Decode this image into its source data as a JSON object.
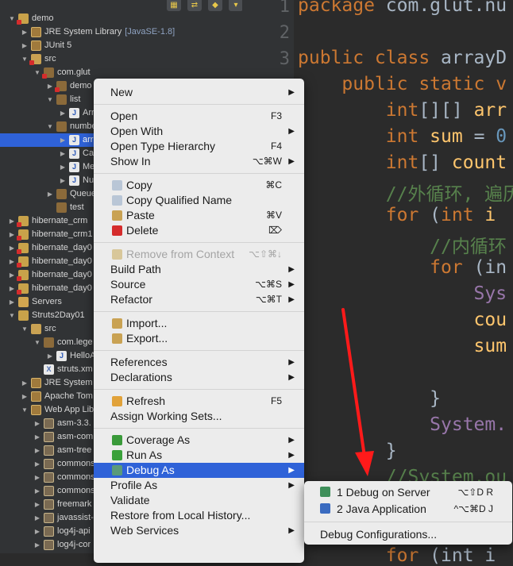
{
  "explorer": {
    "rows": [
      {
        "label": "demo",
        "deco": "",
        "arrow": "▼",
        "indent": 0,
        "icon": "ic-project",
        "err": true
      },
      {
        "label": "JRE System Library",
        "deco": "[JavaSE-1.8]",
        "arrow": "▶",
        "indent": 1,
        "icon": "ic-lib",
        "err": false
      },
      {
        "label": "JUnit 5",
        "deco": "",
        "arrow": "▶",
        "indent": 1,
        "icon": "ic-lib",
        "err": false
      },
      {
        "label": "src",
        "deco": "",
        "arrow": "▼",
        "indent": 1,
        "icon": "ic-src",
        "err": true
      },
      {
        "label": "com.glut",
        "deco": "",
        "arrow": "▼",
        "indent": 2,
        "icon": "ic-pkg",
        "err": true
      },
      {
        "label": "demo",
        "deco": "",
        "arrow": "▶",
        "indent": 3,
        "icon": "ic-pkg",
        "err": true
      },
      {
        "label": "list",
        "deco": "",
        "arrow": "▼",
        "indent": 3,
        "icon": "ic-pkg",
        "err": false
      },
      {
        "label": "Arr",
        "deco": "",
        "arrow": "▶",
        "indent": 4,
        "icon": "ic-java",
        "err": false
      },
      {
        "label": "numbe",
        "deco": "",
        "arrow": "▼",
        "indent": 3,
        "icon": "ic-pkg",
        "err": false
      },
      {
        "label": "arra",
        "deco": "",
        "arrow": "▶",
        "indent": 4,
        "icon": "ic-java",
        "err": false,
        "selected": true
      },
      {
        "label": "Cal",
        "deco": "",
        "arrow": "▶",
        "indent": 4,
        "icon": "ic-java",
        "err": false
      },
      {
        "label": "Me",
        "deco": "",
        "arrow": "▶",
        "indent": 4,
        "icon": "ic-java",
        "err": false
      },
      {
        "label": "Nu",
        "deco": "",
        "arrow": "▶",
        "indent": 4,
        "icon": "ic-java",
        "err": false
      },
      {
        "label": "Queue",
        "deco": "",
        "arrow": "▶",
        "indent": 3,
        "icon": "ic-pkg",
        "err": false
      },
      {
        "label": "test",
        "deco": "",
        "arrow": "",
        "indent": 3,
        "icon": "ic-pkg",
        "err": false
      },
      {
        "label": "hibernate_crm",
        "deco": "",
        "arrow": "▶",
        "indent": 0,
        "icon": "ic-project",
        "err": true
      },
      {
        "label": "hibernate_crm1",
        "deco": "",
        "arrow": "▶",
        "indent": 0,
        "icon": "ic-project",
        "err": true
      },
      {
        "label": "hibernate_day0",
        "deco": "",
        "arrow": "▶",
        "indent": 0,
        "icon": "ic-project",
        "err": true
      },
      {
        "label": "hibernate_day0",
        "deco": "",
        "arrow": "▶",
        "indent": 0,
        "icon": "ic-project",
        "err": true
      },
      {
        "label": "hibernate_day0",
        "deco": "",
        "arrow": "▶",
        "indent": 0,
        "icon": "ic-project",
        "err": true
      },
      {
        "label": "hibernate_day0",
        "deco": "",
        "arrow": "▶",
        "indent": 0,
        "icon": "ic-project",
        "err": true
      },
      {
        "label": "Servers",
        "deco": "",
        "arrow": "▶",
        "indent": 0,
        "icon": "ic-folder",
        "err": false
      },
      {
        "label": "Struts2Day01",
        "deco": "",
        "arrow": "▼",
        "indent": 0,
        "icon": "ic-project",
        "err": false
      },
      {
        "label": "src",
        "deco": "",
        "arrow": "▼",
        "indent": 1,
        "icon": "ic-src",
        "err": false
      },
      {
        "label": "com.lege",
        "deco": "",
        "arrow": "▼",
        "indent": 2,
        "icon": "ic-pkg",
        "err": false
      },
      {
        "label": "HelloA",
        "deco": "",
        "arrow": "▶",
        "indent": 3,
        "icon": "ic-java",
        "err": false
      },
      {
        "label": "struts.xm",
        "deco": "",
        "arrow": "",
        "indent": 2,
        "icon": "ic-xml",
        "err": false
      },
      {
        "label": "JRE System",
        "deco": "",
        "arrow": "▶",
        "indent": 1,
        "icon": "ic-lib",
        "err": false
      },
      {
        "label": "Apache Tom",
        "deco": "",
        "arrow": "▶",
        "indent": 1,
        "icon": "ic-lib",
        "err": false
      },
      {
        "label": "Web App Libr",
        "deco": "",
        "arrow": "▼",
        "indent": 1,
        "icon": "ic-lib",
        "err": false
      },
      {
        "label": "asm-3.3.",
        "deco": "",
        "arrow": "▶",
        "indent": 2,
        "icon": "ic-jar",
        "err": false
      },
      {
        "label": "asm-com",
        "deco": "",
        "arrow": "▶",
        "indent": 2,
        "icon": "ic-jar",
        "err": false
      },
      {
        "label": "asm-tree",
        "deco": "",
        "arrow": "▶",
        "indent": 2,
        "icon": "ic-jar",
        "err": false
      },
      {
        "label": "commons",
        "deco": "",
        "arrow": "▶",
        "indent": 2,
        "icon": "ic-jar",
        "err": false
      },
      {
        "label": "commons",
        "deco": "",
        "arrow": "▶",
        "indent": 2,
        "icon": "ic-jar",
        "err": false
      },
      {
        "label": "commons",
        "deco": "",
        "arrow": "▶",
        "indent": 2,
        "icon": "ic-jar",
        "err": false
      },
      {
        "label": "freemark",
        "deco": "",
        "arrow": "▶",
        "indent": 2,
        "icon": "ic-jar",
        "err": false
      },
      {
        "label": "javassist-",
        "deco": "",
        "arrow": "▶",
        "indent": 2,
        "icon": "ic-jar",
        "err": false
      },
      {
        "label": "log4j-api",
        "deco": "",
        "arrow": "▶",
        "indent": 2,
        "icon": "ic-jar",
        "err": false
      },
      {
        "label": "log4j-cor",
        "deco": "",
        "arrow": "▶",
        "indent": 2,
        "icon": "ic-jar",
        "err": false
      }
    ]
  },
  "editor": {
    "line_numbers": [
      "1",
      "2",
      "3"
    ],
    "lines": [
      [
        {
          "t": "package ",
          "c": "kw"
        },
        {
          "t": "com.glut.nu",
          "c": ""
        }
      ],
      [],
      [
        {
          "t": "public class ",
          "c": "kw"
        },
        {
          "t": "arrayD",
          "c": ""
        }
      ],
      [
        {
          "t": "    public static v",
          "c": "kw"
        }
      ],
      [
        {
          "t": "        int",
          "c": "kw"
        },
        {
          "t": "[][] ",
          "c": ""
        },
        {
          "t": "arr",
          "c": "fn"
        }
      ],
      [
        {
          "t": "        int ",
          "c": "kw"
        },
        {
          "t": "sum",
          "c": "fn"
        },
        {
          "t": " = ",
          "c": ""
        },
        {
          "t": "0",
          "c": "num"
        }
      ],
      [
        {
          "t": "        int",
          "c": "kw"
        },
        {
          "t": "[] ",
          "c": ""
        },
        {
          "t": "count",
          "c": "fn"
        }
      ],
      [
        {
          "t": "        //外循环, 遍历",
          "c": "cm"
        }
      ],
      [
        {
          "t": "        for ",
          "c": "kw"
        },
        {
          "t": "(",
          "c": ""
        },
        {
          "t": "int ",
          "c": "kw"
        },
        {
          "t": "i",
          "c": "fn"
        }
      ],
      [
        {
          "t": "            //内循环",
          "c": "cm"
        }
      ],
      [
        {
          "t": "            for ",
          "c": "kw"
        },
        {
          "t": "(in",
          "c": ""
        }
      ],
      [
        {
          "t": "                Sys",
          "c": "fld"
        }
      ],
      [
        {
          "t": "                cou",
          "c": "fn"
        }
      ],
      [
        {
          "t": "                sum",
          "c": "fn"
        }
      ],
      [],
      [
        {
          "t": "            }",
          "c": ""
        }
      ],
      [
        {
          "t": "            System.",
          "c": "fld"
        }
      ],
      [
        {
          "t": "        }",
          "c": ""
        }
      ],
      [
        {
          "t": "        //System.ou",
          "c": "cm"
        }
      ],
      [],
      [],
      [
        {
          "t": "        for ",
          "c": "kw"
        },
        {
          "t": "(int i",
          "c": ""
        }
      ]
    ]
  },
  "toolbar": {
    "buttons": [
      "▦",
      "⇄",
      "◆",
      "▾"
    ]
  },
  "context_menu": {
    "items": [
      {
        "type": "item",
        "label": "New",
        "shortcut": "",
        "submenu": true,
        "icon": ""
      },
      {
        "type": "sep"
      },
      {
        "type": "item",
        "label": "Open",
        "shortcut": "F3",
        "submenu": false,
        "icon": ""
      },
      {
        "type": "item",
        "label": "Open With",
        "shortcut": "",
        "submenu": true,
        "icon": ""
      },
      {
        "type": "item",
        "label": "Open Type Hierarchy",
        "shortcut": "F4",
        "submenu": false,
        "icon": ""
      },
      {
        "type": "item",
        "label": "Show In",
        "shortcut": "⌥⌘W",
        "submenu": true,
        "icon": ""
      },
      {
        "type": "sep"
      },
      {
        "type": "item",
        "label": "Copy",
        "shortcut": "⌘C",
        "submenu": false,
        "icon": "#b9c6d6"
      },
      {
        "type": "item",
        "label": "Copy Qualified Name",
        "shortcut": "",
        "submenu": false,
        "icon": "#b9c6d6"
      },
      {
        "type": "item",
        "label": "Paste",
        "shortcut": "⌘V",
        "submenu": false,
        "icon": "#c9a253"
      },
      {
        "type": "item",
        "label": "Delete",
        "shortcut": "⌦",
        "submenu": false,
        "icon": "#d52c2c"
      },
      {
        "type": "sep"
      },
      {
        "type": "item",
        "label": "Remove from Context",
        "shortcut": "⌥⇧⌘↓",
        "submenu": false,
        "icon": "#d8c79a",
        "disabled": true
      },
      {
        "type": "item",
        "label": "Build Path",
        "shortcut": "",
        "submenu": true,
        "icon": ""
      },
      {
        "type": "item",
        "label": "Source",
        "shortcut": "⌥⌘S",
        "submenu": true,
        "icon": ""
      },
      {
        "type": "item",
        "label": "Refactor",
        "shortcut": "⌥⌘T",
        "submenu": true,
        "icon": ""
      },
      {
        "type": "sep"
      },
      {
        "type": "item",
        "label": "Import...",
        "shortcut": "",
        "submenu": false,
        "icon": "#c9a253"
      },
      {
        "type": "item",
        "label": "Export...",
        "shortcut": "",
        "submenu": false,
        "icon": "#c9a253"
      },
      {
        "type": "sep"
      },
      {
        "type": "item",
        "label": "References",
        "shortcut": "",
        "submenu": true,
        "icon": ""
      },
      {
        "type": "item",
        "label": "Declarations",
        "shortcut": "",
        "submenu": true,
        "icon": ""
      },
      {
        "type": "sep"
      },
      {
        "type": "item",
        "label": "Refresh",
        "shortcut": "F5",
        "submenu": false,
        "icon": "#e1a23a"
      },
      {
        "type": "item",
        "label": "Assign Working Sets...",
        "shortcut": "",
        "submenu": false,
        "icon": ""
      },
      {
        "type": "sep"
      },
      {
        "type": "item",
        "label": "Coverage As",
        "shortcut": "",
        "submenu": true,
        "icon": "#3a9a3a"
      },
      {
        "type": "item",
        "label": "Run As",
        "shortcut": "",
        "submenu": true,
        "icon": "#3aa13a"
      },
      {
        "type": "item",
        "label": "Debug As",
        "shortcut": "",
        "submenu": true,
        "icon": "#5a9a7a",
        "highlighted": true
      },
      {
        "type": "item",
        "label": "Profile As",
        "shortcut": "",
        "submenu": true,
        "icon": ""
      },
      {
        "type": "item",
        "label": "Validate",
        "shortcut": "",
        "submenu": false,
        "icon": ""
      },
      {
        "type": "item",
        "label": "Restore from Local History...",
        "shortcut": "",
        "submenu": false,
        "icon": ""
      },
      {
        "type": "item",
        "label": "Web Services",
        "shortcut": "",
        "submenu": true,
        "icon": ""
      }
    ]
  },
  "debug_submenu": {
    "items": [
      {
        "type": "item",
        "label": "1 Debug on Server",
        "shortcut": "⌥⇧D R",
        "icon": "#3f8f5a"
      },
      {
        "type": "item",
        "label": "2 Java Application",
        "shortcut": "^⌥⌘D J",
        "icon": "#3a6bc0"
      },
      {
        "type": "sep"
      },
      {
        "type": "item",
        "label": "Debug Configurations...",
        "shortcut": "",
        "icon": ""
      }
    ]
  },
  "colors": {
    "accent": "#2f62d8",
    "arrow": "#ff1a1a",
    "menu_bg": "#ececec",
    "editor_bg": "#2b2b2b"
  }
}
